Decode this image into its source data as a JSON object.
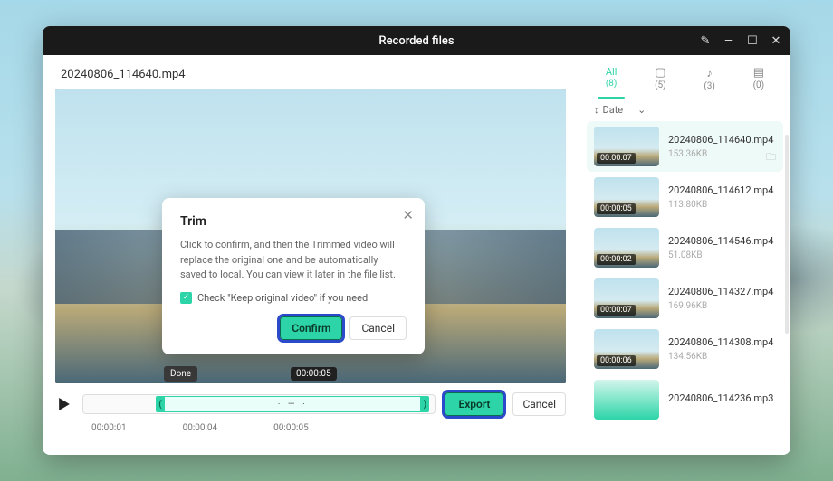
{
  "window": {
    "title": "Recorded files"
  },
  "current_file": "20240806_114640.mp4",
  "done_tip": "Done",
  "time_tooltip": "00:00:05",
  "export_label": "Export",
  "cancel_label": "Cancel",
  "ticks": [
    "00:00:01",
    "00:00:04",
    "00:00:05"
  ],
  "tabs": [
    {
      "label": "All",
      "count": "(8)"
    },
    {
      "label": "",
      "count": "(5)",
      "icon": "▢"
    },
    {
      "label": "",
      "count": "(3)",
      "icon": "♪"
    },
    {
      "label": "",
      "count": "(0)",
      "icon": "▤"
    }
  ],
  "sort_label": "Date",
  "files": [
    {
      "name": "20240806_114640.mp4",
      "size": "153.36KB",
      "dur": "00:00:07"
    },
    {
      "name": "20240806_114612.mp4",
      "size": "113.80KB",
      "dur": "00:00:05"
    },
    {
      "name": "20240806_114546.mp4",
      "size": "51.08KB",
      "dur": "00:00:02"
    },
    {
      "name": "20240806_114327.mp4",
      "size": "169.96KB",
      "dur": "00:00:07"
    },
    {
      "name": "20240806_114308.mp4",
      "size": "134.56KB",
      "dur": "00:00:06"
    },
    {
      "name": "20240806_114236.mp3",
      "size": "",
      "dur": "",
      "audio": true
    }
  ],
  "modal": {
    "title": "Trim",
    "text": "Click to confirm, and then the Trimmed video will replace the original one and be automatically saved to local. You can view it later in the file list.",
    "check_label": "Check \"Keep original video\" if you need",
    "confirm": "Confirm",
    "cancel": "Cancel"
  }
}
